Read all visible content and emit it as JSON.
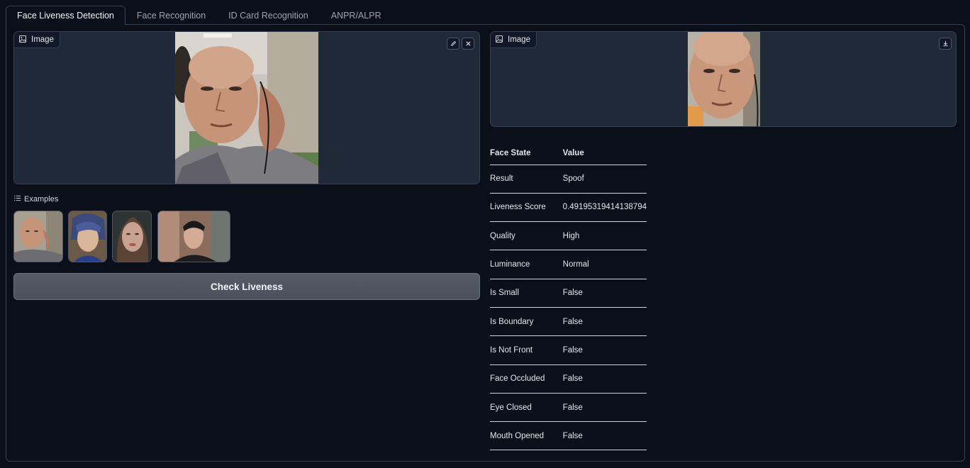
{
  "tabs": [
    {
      "label": "Face Liveness Detection",
      "active": true
    },
    {
      "label": "Face Recognition",
      "active": false
    },
    {
      "label": "ID Card Recognition",
      "active": false
    },
    {
      "label": "ANPR/ALPR",
      "active": false
    }
  ],
  "input_image": {
    "label": "Image",
    "edit_icon": "pencil-icon",
    "close_icon": "close-icon"
  },
  "output_image": {
    "label": "Image",
    "download_icon": "download-icon"
  },
  "examples": {
    "label": "Examples",
    "count": 4
  },
  "check_button": {
    "label": "Check Liveness"
  },
  "results": {
    "headers": [
      "Face State",
      "Value"
    ],
    "rows": [
      [
        "Result",
        "Spoof"
      ],
      [
        "Liveness Score",
        "0.49195319414138794"
      ],
      [
        "Quality",
        "High"
      ],
      [
        "Luminance",
        "Normal"
      ],
      [
        "Is Small",
        "False"
      ],
      [
        "Is Boundary",
        "False"
      ],
      [
        "Is Not Front",
        "False"
      ],
      [
        "Face Occluded",
        "False"
      ],
      [
        "Eye Closed",
        "False"
      ],
      [
        "Mouth Opened",
        "False"
      ]
    ]
  },
  "colors": {
    "background": "#0b0f19",
    "panel_border": "#374151",
    "image_bg": "#1f2937",
    "button_bg": "#4f5661"
  }
}
